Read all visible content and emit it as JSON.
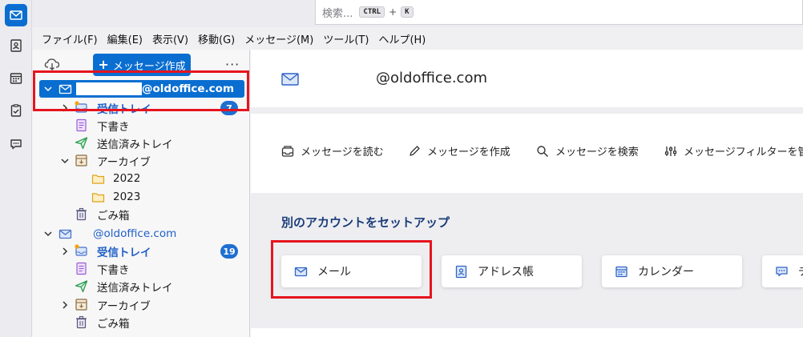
{
  "search": {
    "placeholder": "検索...",
    "key_modifier": "CTRL",
    "key_plus": "+",
    "key_letter": "K"
  },
  "menubar": [
    "ファイル(F)",
    "編集(E)",
    "表示(V)",
    "移動(G)",
    "メッセージ(M)",
    "ツール(T)",
    "ヘルプ(H)"
  ],
  "folder_pane": {
    "compose_label": "メッセージ作成",
    "more_label": "···",
    "account1": {
      "name": "@oldoffice.com",
      "folders": {
        "inbox": "受信トレイ",
        "inbox_unread": "7",
        "drafts": "下書き",
        "sent": "送信済みトレイ",
        "archive": "アーカイブ",
        "archive_2022": "2022",
        "archive_2023": "2023",
        "trash": "ごみ箱"
      }
    },
    "account2": {
      "name": "@oldoffice.com",
      "folders": {
        "inbox": "受信トレイ",
        "inbox_unread": "19",
        "drafts": "下書き",
        "sent": "送信済みトレイ",
        "archive": "アーカイブ",
        "trash": "ごみ箱"
      }
    }
  },
  "main": {
    "account_title": "@oldoffice.com",
    "actions": [
      "メッセージを読む",
      "メッセージを作成",
      "メッセージを検索",
      "メッセージフィルターを管理"
    ],
    "setup_title": "別のアカウントをセットアップ",
    "setup_cards": [
      "メール",
      "アドレス帳",
      "カレンダー",
      "チ"
    ]
  },
  "colors": {
    "accent": "#0a6ed1",
    "highlight": "#e6141e",
    "badge": "#1f6fd1",
    "setup_title": "#1a3c7a"
  }
}
